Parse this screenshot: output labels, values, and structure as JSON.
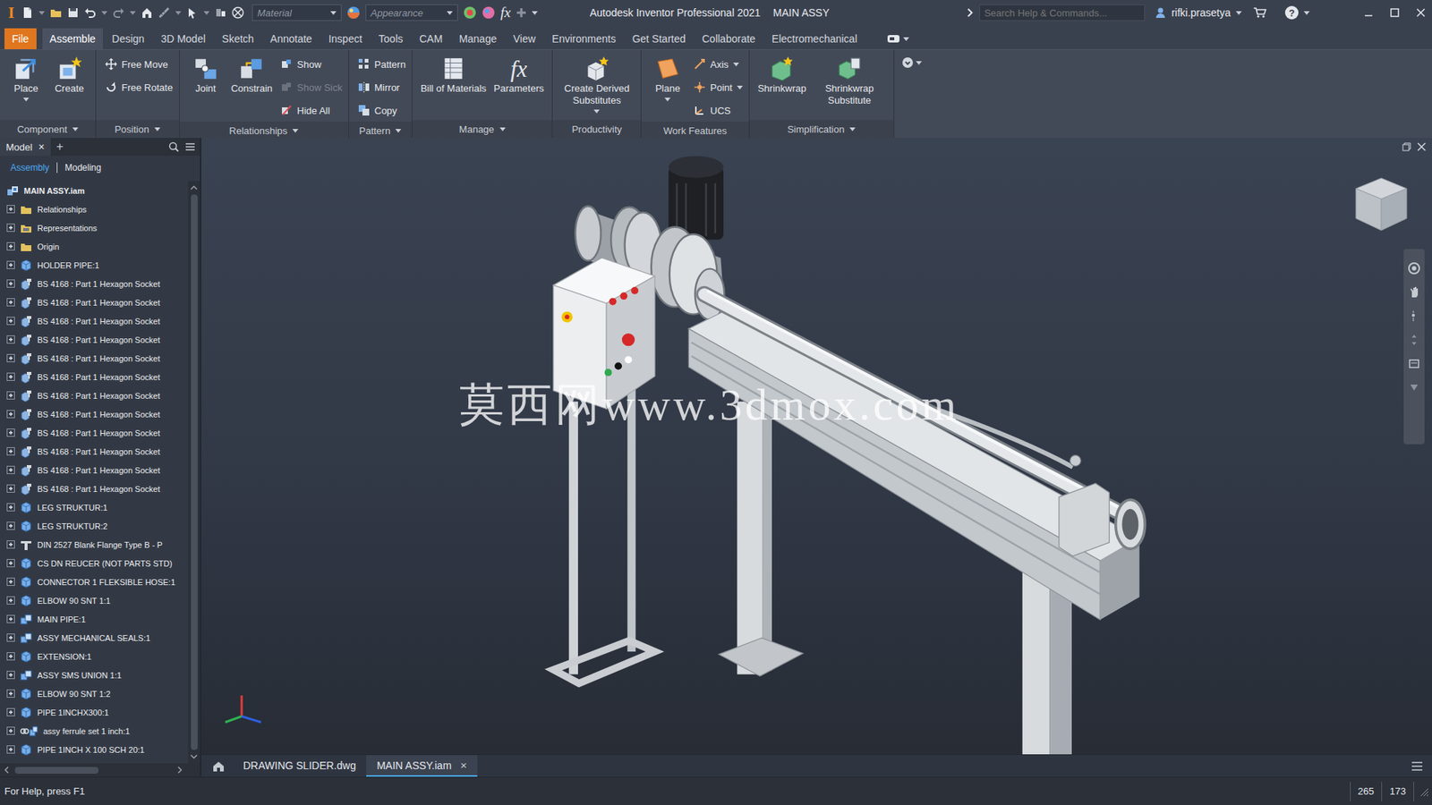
{
  "title_bar": {
    "logo": "I",
    "material": "Material",
    "appearance": "Appearance",
    "fx": "fx",
    "title": "Autodesk Inventor Professional 2021",
    "document": "MAIN ASSY",
    "search": {
      "placeholder": "Search Help & Commands..."
    },
    "user": "rifki.prasetya",
    "help": "?"
  },
  "menu_tabs": [
    {
      "label": "File",
      "kind": "file",
      "selected": false
    },
    {
      "label": "Assemble",
      "kind": "tab",
      "selected": true
    },
    {
      "label": "Design",
      "kind": "tab",
      "selected": false
    },
    {
      "label": "3D Model",
      "kind": "tab",
      "selected": false
    },
    {
      "label": "Sketch",
      "kind": "tab",
      "selected": false
    },
    {
      "label": "Annotate",
      "kind": "tab",
      "selected": false
    },
    {
      "label": "Inspect",
      "kind": "tab",
      "selected": false
    },
    {
      "label": "Tools",
      "kind": "tab",
      "selected": false
    },
    {
      "label": "CAM",
      "kind": "tab",
      "selected": false
    },
    {
      "label": "Manage",
      "kind": "tab",
      "selected": false
    },
    {
      "label": "View",
      "kind": "tab",
      "selected": false
    },
    {
      "label": "Environments",
      "kind": "tab",
      "selected": false
    },
    {
      "label": "Get Started",
      "kind": "tab",
      "selected": false
    },
    {
      "label": "Collaborate",
      "kind": "tab",
      "selected": false
    },
    {
      "label": "Electromechanical",
      "kind": "tab",
      "selected": false
    }
  ],
  "ribbon": {
    "panels": [
      {
        "title": "Component",
        "menu": true,
        "tools": [
          {
            "label": "Place",
            "kind": "large",
            "menu": true,
            "disabled": false
          },
          {
            "label": "Create",
            "kind": "large",
            "menu": false,
            "disabled": false
          }
        ]
      },
      {
        "title": "Position",
        "menu": true,
        "tools": [
          {
            "label": "Free Move",
            "kind": "small",
            "menu": false,
            "disabled": false
          },
          {
            "label": "Free Rotate",
            "kind": "small",
            "menu": false,
            "disabled": false
          }
        ]
      },
      {
        "title": "Relationships",
        "menu": true,
        "tools": [
          {
            "label": "Joint",
            "kind": "large",
            "menu": false,
            "disabled": false
          },
          {
            "label": "Constrain",
            "kind": "large",
            "menu": false,
            "disabled": false
          },
          {
            "label": "Show",
            "kind": "small",
            "menu": false,
            "disabled": false
          },
          {
            "label": "Show Sick",
            "kind": "small",
            "menu": false,
            "disabled": true
          },
          {
            "label": "Hide All",
            "kind": "small",
            "menu": false,
            "disabled": false
          }
        ]
      },
      {
        "title": "Pattern",
        "menu": true,
        "tools": [
          {
            "label": "Pattern",
            "kind": "small",
            "menu": false,
            "disabled": false
          },
          {
            "label": "Mirror",
            "kind": "small",
            "menu": false,
            "disabled": false
          },
          {
            "label": "Copy",
            "kind": "small",
            "menu": false,
            "disabled": false
          }
        ]
      },
      {
        "title": "Manage",
        "menu": true,
        "tools": [
          {
            "label": "Bill of Materials",
            "kind": "large",
            "menu": false,
            "disabled": false
          },
          {
            "label": "Parameters",
            "kind": "large",
            "menu": false,
            "disabled": false,
            "icon_text": "fx"
          }
        ]
      },
      {
        "title": "Productivity",
        "menu": false,
        "tools": [
          {
            "label": "Create Derived Substitutes",
            "kind": "large",
            "menu": true,
            "disabled": false
          }
        ]
      },
      {
        "title": "Work Features",
        "menu": false,
        "tools": [
          {
            "label": "Plane",
            "kind": "large",
            "menu": true,
            "disabled": false
          },
          {
            "label": "Axis",
            "kind": "small",
            "menu": true,
            "disabled": false
          },
          {
            "label": "Point",
            "kind": "small",
            "menu": true,
            "disabled": false
          },
          {
            "label": "UCS",
            "kind": "small",
            "menu": false,
            "disabled": false
          }
        ]
      },
      {
        "title": "Simplification",
        "menu": true,
        "tools": [
          {
            "label": "Shrinkwrap",
            "kind": "large",
            "menu": false,
            "disabled": false
          },
          {
            "label": "Shrinkwrap Substitute",
            "kind": "large",
            "menu": false,
            "disabled": false
          }
        ]
      }
    ]
  },
  "browser": {
    "tab": "Model",
    "close": "×",
    "add": "+",
    "views": [
      {
        "label": "Assembly",
        "selected": true
      },
      {
        "label": "Modeling",
        "selected": false
      }
    ],
    "items": [
      {
        "label": "MAIN ASSY.iam",
        "kind": "root"
      },
      {
        "label": "Relationships",
        "kind": "folder",
        "expanded": false
      },
      {
        "label": "Representations",
        "kind": "representations",
        "expanded": false
      },
      {
        "label": "Origin",
        "kind": "folder",
        "expanded": false
      },
      {
        "label": "HOLDER PIPE:1",
        "kind": "part",
        "expanded": false
      },
      {
        "label": "BS 4168 : Part 1 Hexagon Socket",
        "kind": "library-part",
        "expanded": false
      },
      {
        "label": "BS 4168 : Part 1 Hexagon Socket",
        "kind": "library-part",
        "expanded": false
      },
      {
        "label": "BS 4168 : Part 1 Hexagon Socket",
        "kind": "library-part",
        "expanded": false
      },
      {
        "label": "BS 4168 : Part 1 Hexagon Socket",
        "kind": "library-part",
        "expanded": false
      },
      {
        "label": "BS 4168 : Part 1 Hexagon Socket",
        "kind": "library-part",
        "expanded": false
      },
      {
        "label": "BS 4168 : Part 1 Hexagon Socket",
        "kind": "library-part",
        "expanded": false
      },
      {
        "label": "BS 4168 : Part 1 Hexagon Socket",
        "kind": "library-part",
        "expanded": false
      },
      {
        "label": "BS 4168 : Part 1 Hexagon Socket",
        "kind": "library-part",
        "expanded": false
      },
      {
        "label": "BS 4168 : Part 1 Hexagon Socket",
        "kind": "library-part",
        "expanded": false
      },
      {
        "label": "BS 4168 : Part 1 Hexagon Socket",
        "kind": "library-part",
        "expanded": false
      },
      {
        "label": "BS 4168 : Part 1 Hexagon Socket",
        "kind": "library-part",
        "expanded": false
      },
      {
        "label": "BS 4168 : Part 1 Hexagon Socket",
        "kind": "library-part",
        "expanded": false
      },
      {
        "label": "LEG STRUKTUR:1",
        "kind": "part",
        "expanded": false
      },
      {
        "label": "LEG STRUKTUR:2",
        "kind": "part",
        "expanded": false
      },
      {
        "label": "DIN 2527 Blank Flange Type B - P",
        "kind": "content-center",
        "expanded": false
      },
      {
        "label": "CS DN REUCER (NOT PARTS STD)",
        "kind": "part",
        "expanded": false
      },
      {
        "label": "CONNECTOR 1 FLEKSIBLE HOSE:1",
        "kind": "part",
        "expanded": false
      },
      {
        "label": "ELBOW 90 SNT 1:1",
        "kind": "part",
        "expanded": false
      },
      {
        "label": "MAIN PIPE:1",
        "kind": "assembly",
        "expanded": false
      },
      {
        "label": "ASSY MECHANICAL SEALS:1",
        "kind": "assembly",
        "expanded": false
      },
      {
        "label": "EXTENSION:1",
        "kind": "part",
        "expanded": false
      },
      {
        "label": "ASSY SMS UNION 1:1",
        "kind": "assembly",
        "expanded": false
      },
      {
        "label": "ELBOW 90 SNT 1:2",
        "kind": "part",
        "expanded": false
      },
      {
        "label": "PIPE 1INCHX300:1",
        "kind": "part",
        "expanded": false
      },
      {
        "label": "assy ferrule set 1 inch:1",
        "kind": "linked-assembly",
        "expanded": false
      },
      {
        "label": "PIPE 1INCH X 100 SCH 20:1",
        "kind": "part",
        "expanded": false
      }
    ]
  },
  "viewport": {
    "watermark": "莫西网www.3dmox.com"
  },
  "document_tabs": [
    {
      "label": "DRAWING SLIDER.dwg",
      "selected": false
    },
    {
      "label": "MAIN ASSY.iam",
      "selected": true,
      "close": "×"
    }
  ],
  "status_bar": {
    "help": "For Help, press F1",
    "values": [
      "265",
      "173"
    ]
  }
}
